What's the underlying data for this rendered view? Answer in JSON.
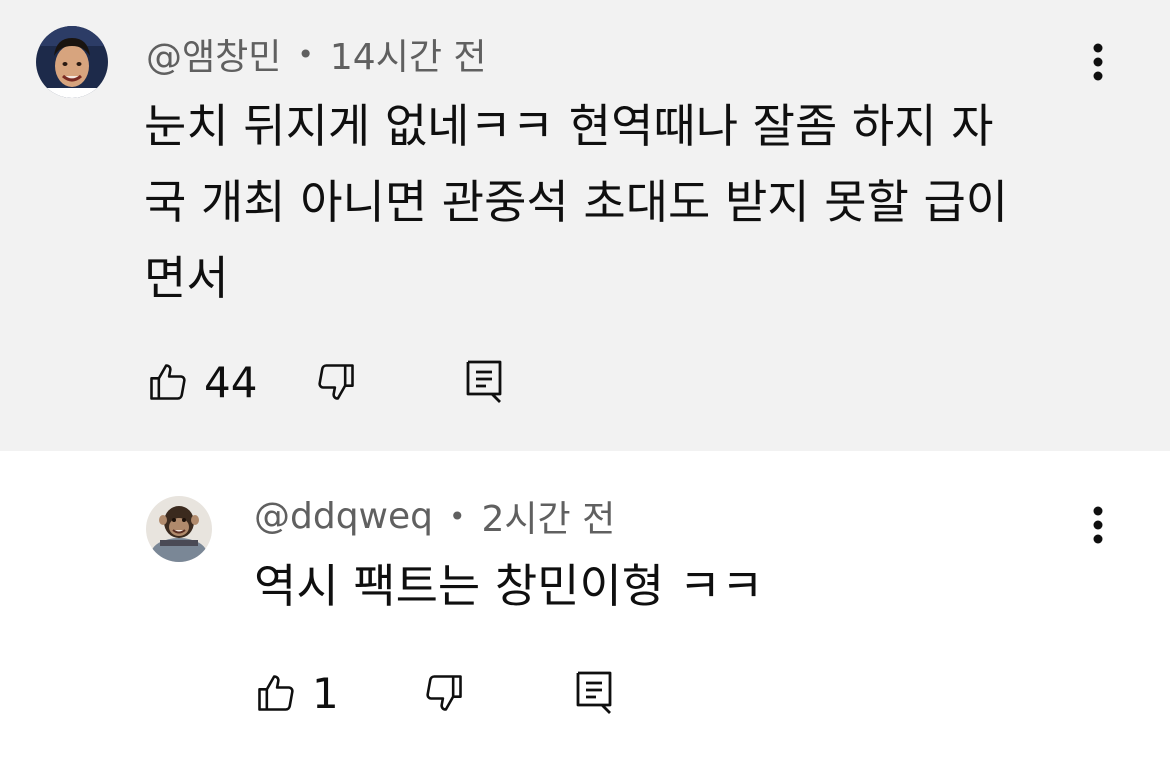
{
  "comments": [
    {
      "username": "@앰창민",
      "separator": "•",
      "time": "14시간 전",
      "text": "눈치 뒤지게 없네ㅋㅋ 현역때나 잘좀 하지 자\n국 개최 아니면 관중석 초대도 받지 못할 급이\n면서",
      "likes": "44",
      "avatar_icon": "avatar-photo-soccer-player"
    },
    {
      "username": "@ddqweq",
      "separator": "•",
      "time": "2시간 전",
      "text": "역시 팩트는 창민이형 ㅋㅋ",
      "likes": "1",
      "avatar_icon": "avatar-photo-chimpanzee"
    }
  ],
  "icons": {
    "like": "thumbs-up-icon",
    "dislike": "thumbs-down-icon",
    "reply": "reply-comment-icon",
    "more": "more-vertical-icon"
  },
  "colors": {
    "highlight_background": "#f2f2f2",
    "text_primary": "#0f0f0f",
    "text_secondary": "#606060"
  }
}
